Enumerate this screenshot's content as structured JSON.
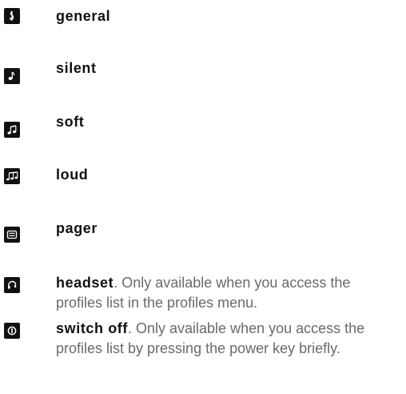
{
  "profiles": [
    {
      "icon": "treble-clef-icon",
      "label": "general"
    },
    {
      "icon": "single-note-icon",
      "label": "silent"
    },
    {
      "icon": "double-note-icon",
      "label": "soft"
    },
    {
      "icon": "triple-note-icon",
      "label": "loud"
    },
    {
      "icon": "pager-icon",
      "label": "pager"
    },
    {
      "icon": "headset-icon",
      "label": "headset",
      "description": ". Only available when you access the profiles list in the profiles menu."
    },
    {
      "icon": "power-icon",
      "label": "switch off",
      "description": ". Only available when you access the profiles list by pressing the power key briefly."
    }
  ]
}
